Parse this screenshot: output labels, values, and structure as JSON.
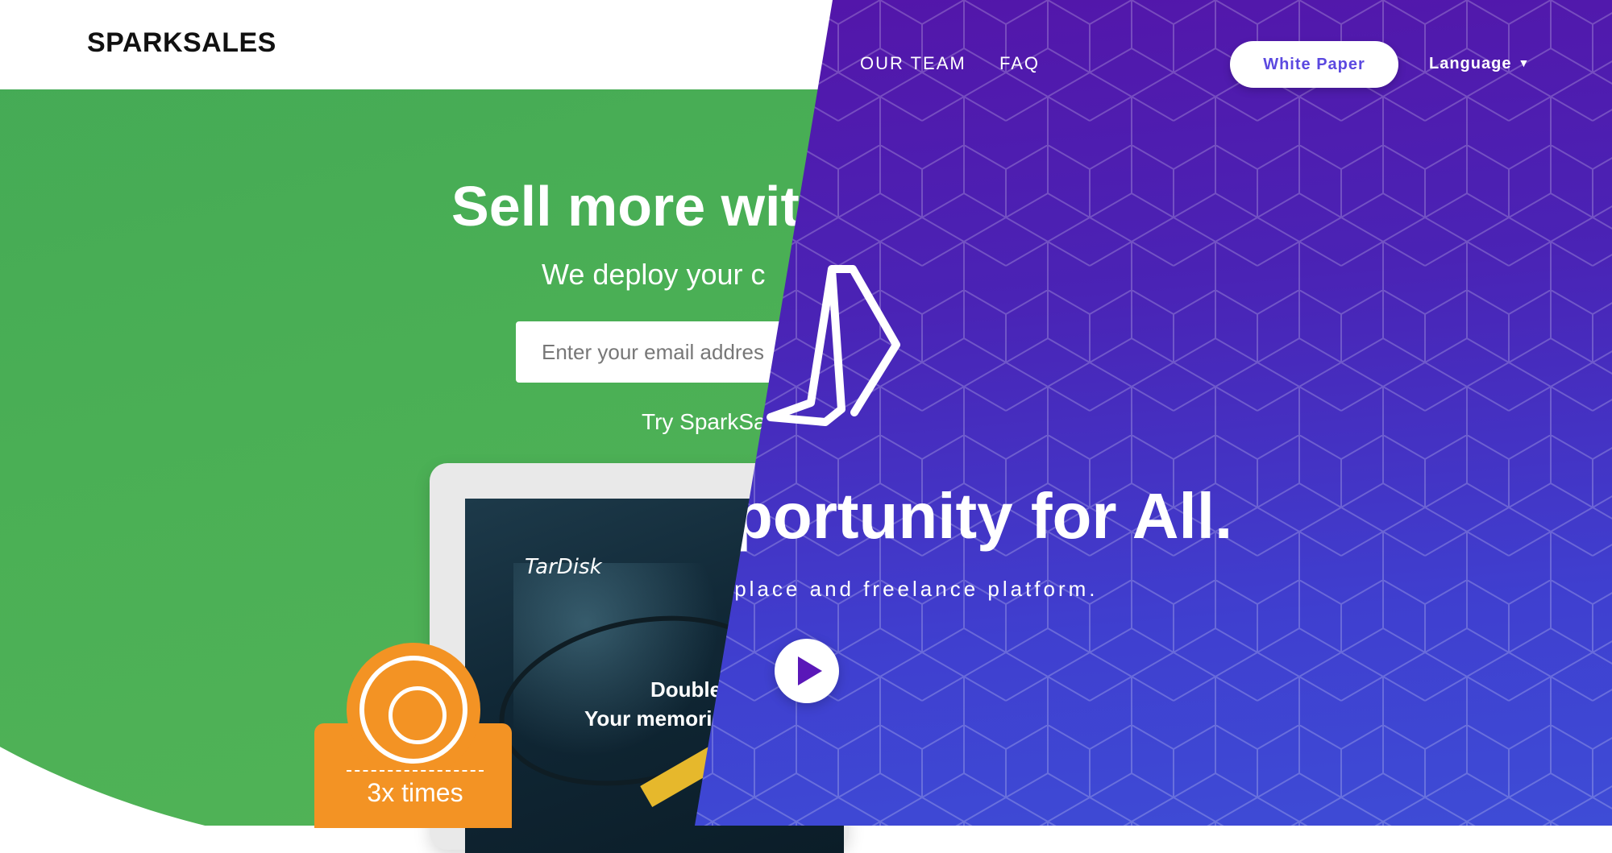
{
  "left_site": {
    "logo": "SPARKSALES",
    "hero_title": "Sell more with",
    "hero_subtitle": "We deploy your c",
    "email_placeholder": "Enter your email addres",
    "try_link": "Try SparkSa",
    "device": {
      "brand": "TarDisk",
      "line1": "Double",
      "line2": "Your memories"
    },
    "badge_text": "3x times"
  },
  "right_site": {
    "nav": [
      "OUR TEAM",
      "FAQ"
    ],
    "white_paper_label": "White Paper",
    "language_label": "Language",
    "headline": "portunity for All.",
    "subline": "tplace and freelance platform."
  },
  "colors": {
    "green": "#4aaf55",
    "purple_top": "#5513a7",
    "purple_bottom": "#3e4cd6",
    "badge_orange": "#f39324",
    "white_paper_text": "#5b49e0"
  },
  "icons": [
    "logo-emblem-icon",
    "play-icon",
    "caret-down-icon",
    "refresh-chart-icon"
  ]
}
